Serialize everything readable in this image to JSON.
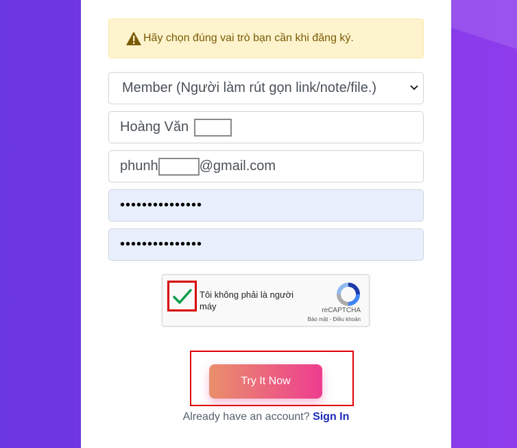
{
  "alert": {
    "text": "Hãy chọn đúng vai trò bạn cần khi đăng ký."
  },
  "form": {
    "role_select_value": "Member (Người làm rút gọn link/note/file.)",
    "name_value": "Hoàng Văn",
    "email_prefix": "phunh",
    "email_suffix": "@gmail.com",
    "password_mask": "•••••••••••••••",
    "confirm_password_mask": "•••••••••••••••"
  },
  "captcha": {
    "label": "Tôi không phải là người máy",
    "brand": "reCAPTCHA",
    "terms": "Bảo mật - Điều khoản",
    "checked": true
  },
  "cta": {
    "label": "Try It Now"
  },
  "signin": {
    "prompt": "Already have an account?",
    "link": "Sign In"
  },
  "colors": {
    "alert_bg": "#fdf3cd",
    "alert_text": "#7a5b05",
    "cta_gradient_start": "#e9906c",
    "cta_gradient_end": "#ee3d8f",
    "link": "#1a28b8",
    "highlight": "#e00000"
  }
}
